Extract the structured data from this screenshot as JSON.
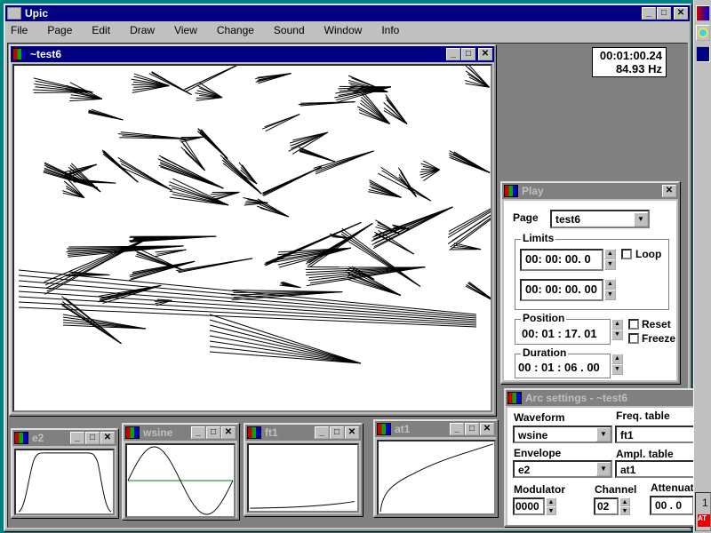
{
  "app": {
    "title": "Upic",
    "menu": [
      "File",
      "Page",
      "Edit",
      "Draw",
      "View",
      "Change",
      "Sound",
      "Window",
      "Info"
    ]
  },
  "status": {
    "time": "00:01:00.24",
    "freq": "84.93 Hz"
  },
  "doc": {
    "title": "~test6"
  },
  "play": {
    "title": "Play",
    "page_label": "Page",
    "page_value": "test6",
    "limits_label": "Limits",
    "limit_start": "00: 00: 00. 0",
    "limit_end": "00: 00: 00. 00",
    "loop_label": "Loop",
    "position_label": "Position",
    "position_value": "00: 01 : 17. 01",
    "reset_label": "Reset",
    "freeze_label": "Freeze",
    "duration_label": "Duration",
    "duration_value": "00 : 01 : 06 . 00"
  },
  "arc": {
    "title": "Arc settings - ~test6",
    "waveform_label": "Waveform",
    "waveform_value": "wsine",
    "freq_label": "Freq. table",
    "freq_value": "ft1",
    "envelope_label": "Envelope",
    "envelope_value": "e2",
    "ampl_label": "Ampl. table",
    "ampl_value": "at1",
    "modulator_label": "Modulator",
    "modulator_value": "0000",
    "channel_label": "Channel",
    "channel_value": "02",
    "atten_label": "Attenuat",
    "atten_value": "00 . 0"
  },
  "mini": [
    {
      "title": "e2"
    },
    {
      "title": "wsine"
    },
    {
      "title": "ft1"
    },
    {
      "title": "at1"
    }
  ],
  "taskbar": {
    "number": "1"
  },
  "colors": {
    "title_active": "#000080",
    "desktop": "#008080",
    "axis_line": "#008000"
  }
}
